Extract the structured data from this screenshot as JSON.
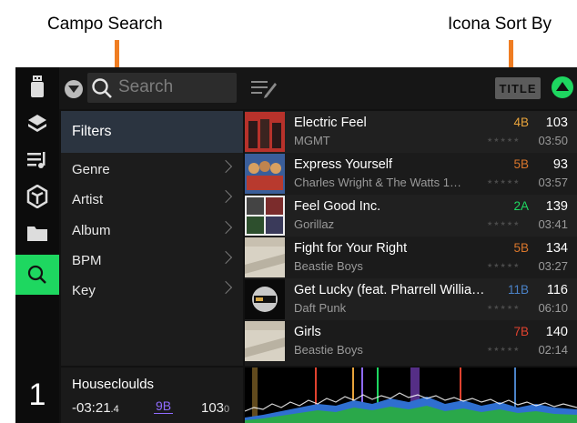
{
  "annotations": {
    "search_callout": "Campo Search",
    "sortby_callout": "Icona Sort By"
  },
  "colors": {
    "accent": "#1ed760",
    "callout_arrow": "#ef7d22",
    "key_orange": "#e8a33b",
    "key_green": "#1ed760",
    "key_blue": "#4a82c7",
    "key_red": "#e0422f",
    "key_purple": "#8f6bff"
  },
  "toolbar": {
    "search_placeholder": "Search",
    "sort_label": "TITLE"
  },
  "sidebar": {
    "icons": [
      "usb-icon",
      "record-crate-icon",
      "playlist-icon",
      "prepare-icon",
      "folder-icon",
      "search-icon"
    ],
    "deck_number": "1"
  },
  "filters": {
    "heading": "Filters",
    "items": [
      "Genre",
      "Artist",
      "Album",
      "BPM",
      "Key"
    ]
  },
  "tracks": [
    {
      "title": "Electric Feel",
      "artist": "MGMT",
      "key": "4B",
      "key_color": "#e8a33b",
      "bpm": "103",
      "length": "03:50"
    },
    {
      "title": "Express Yourself",
      "artist": "Charles Wright & The Watts 1…",
      "key": "5B",
      "key_color": "#d9762b",
      "bpm": "93",
      "length": "03:57"
    },
    {
      "title": "Feel Good Inc.",
      "artist": "Gorillaz",
      "key": "2A",
      "key_color": "#1ed760",
      "bpm": "139",
      "length": "03:41"
    },
    {
      "title": "Fight for Your Right",
      "artist": "Beastie Boys",
      "key": "5B",
      "key_color": "#d9762b",
      "bpm": "134",
      "length": "03:27"
    },
    {
      "title": "Get Lucky (feat. Pharrell Willia…",
      "artist": "Daft Punk",
      "key": "11B",
      "key_color": "#4a82c7",
      "bpm": "116",
      "length": "06:10"
    },
    {
      "title": "Girls",
      "artist": "Beastie Boys",
      "key": "7B",
      "key_color": "#e0422f",
      "bpm": "140",
      "length": "02:14"
    }
  ],
  "now_playing": {
    "title": "Housecloulds",
    "time_main": "-03:21",
    "time_frac": ".4",
    "key": "9B",
    "bpm_main": "103",
    "bpm_frac": "0"
  }
}
